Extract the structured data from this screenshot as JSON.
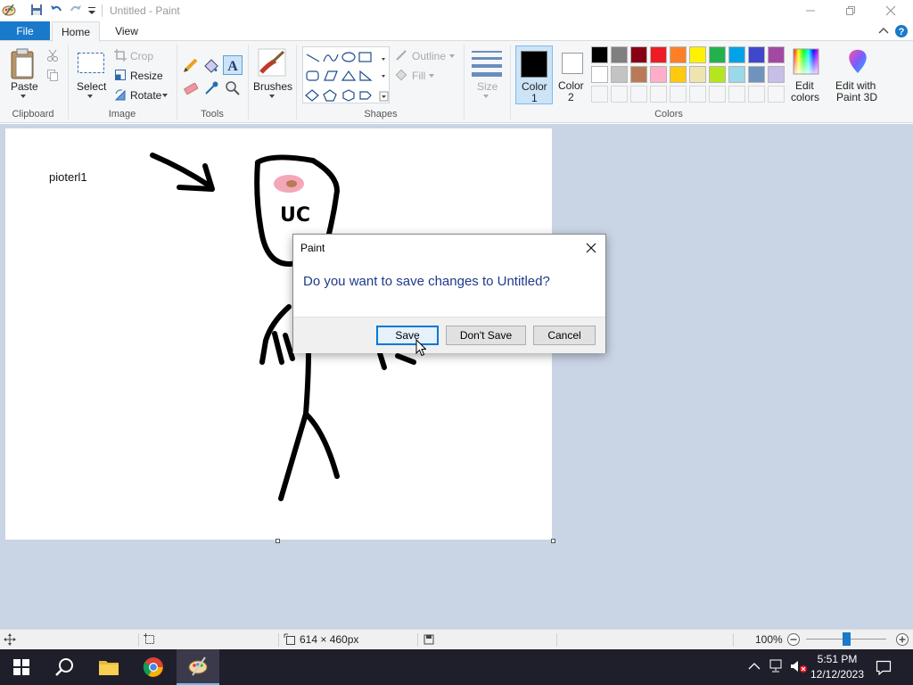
{
  "window": {
    "title": "Untitled - Paint"
  },
  "tabs": {
    "file": "File",
    "home": "Home",
    "view": "View"
  },
  "ribbon": {
    "clipboard": {
      "group": "Clipboard",
      "paste": "Paste"
    },
    "image": {
      "group": "Image",
      "select": "Select",
      "crop": "Crop",
      "resize": "Resize",
      "rotate": "Rotate"
    },
    "tools": {
      "group": "Tools"
    },
    "brushes": {
      "label": "Brushes"
    },
    "shapes": {
      "group": "Shapes",
      "outline": "Outline",
      "fill": "Fill"
    },
    "size": {
      "label": "Size"
    },
    "colors": {
      "group": "Colors",
      "color1_line1": "Color",
      "color1_line2": "1",
      "color2_line1": "Color",
      "color2_line2": "2",
      "edit_line1": "Edit",
      "edit_line2": "colors",
      "paint3d_line1": "Edit with",
      "paint3d_line2": "Paint 3D",
      "color1_value": "#000000",
      "color2_value": "#ffffff",
      "palette_row1": [
        "#000000",
        "#7f7f7f",
        "#880015",
        "#ed1c24",
        "#ff7f27",
        "#fff200",
        "#22b14c",
        "#00a2e8",
        "#3f48cc",
        "#a349a4"
      ],
      "palette_row2": [
        "#ffffff",
        "#c3c3c3",
        "#b97a57",
        "#ffaec9",
        "#ffc90e",
        "#efe4b0",
        "#b5e61d",
        "#99d9ea",
        "#7092be",
        "#c8bfe7"
      ]
    }
  },
  "canvas": {
    "text": "pioterl1",
    "face_letters": "UC"
  },
  "statusbar": {
    "dimensions": "614 × 460px",
    "zoom": "100%",
    "zoom_level": 0.5
  },
  "dialog": {
    "title": "Paint",
    "message": "Do you want to save changes to Untitled?",
    "save": "Save",
    "dont_save": "Don't Save",
    "cancel": "Cancel"
  },
  "taskbar": {
    "time": "5:51 PM",
    "date": "12/12/2023"
  }
}
